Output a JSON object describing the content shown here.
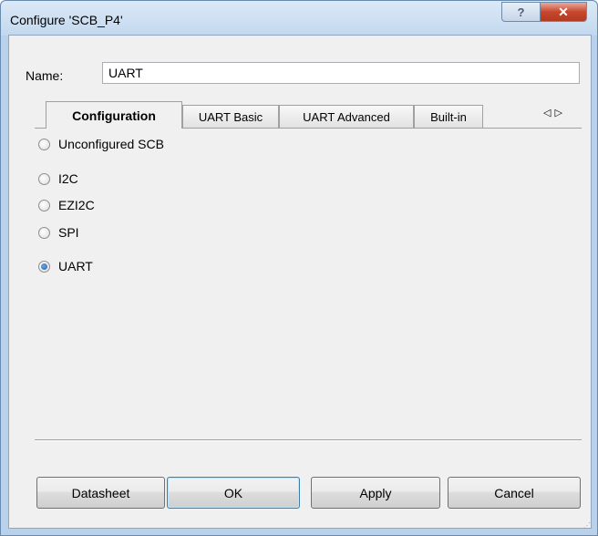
{
  "window": {
    "title": "Configure 'SCB_P4'"
  },
  "titlebar": {
    "help_glyph": "?",
    "close_glyph": "✕"
  },
  "name_field": {
    "label": "Name:",
    "value": "UART"
  },
  "tabs": [
    {
      "label": "Configuration",
      "active": true
    },
    {
      "label": "UART Basic",
      "active": false
    },
    {
      "label": "UART Advanced",
      "active": false
    },
    {
      "label": "Built-in",
      "active": false
    }
  ],
  "tab_scroll": {
    "left_icon": "triangle-left-icon",
    "right_icon": "triangle-right-icon",
    "left_glyph": "◁",
    "right_glyph": "▷"
  },
  "modes": [
    {
      "label": "Unconfigured SCB",
      "checked": false
    },
    {
      "label": "I2C",
      "checked": false
    },
    {
      "label": "EZI2C",
      "checked": false
    },
    {
      "label": "SPI",
      "checked": false
    },
    {
      "label": "UART",
      "checked": true
    }
  ],
  "buttons": {
    "datasheet": "Datasheet",
    "ok": "OK",
    "apply": "Apply",
    "cancel": "Cancel"
  },
  "colors": {
    "accent": "#1d5fb0",
    "close": "#c8472c",
    "frame": "#b9d1ea"
  }
}
